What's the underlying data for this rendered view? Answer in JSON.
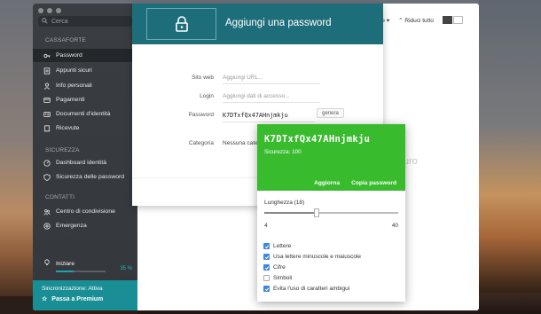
{
  "sidebar": {
    "search_placeholder": "Cerca",
    "section_vault": "CASSAFORTE",
    "vault_items": [
      {
        "label": "Password",
        "icon": "key-icon"
      },
      {
        "label": "Appunti sicuri",
        "icon": "note-icon"
      },
      {
        "label": "Info personali",
        "icon": "person-icon"
      },
      {
        "label": "Pagamenti",
        "icon": "card-icon"
      },
      {
        "label": "Documenti d'identità",
        "icon": "id-card-icon"
      },
      {
        "label": "Ricevute",
        "icon": "receipt-icon"
      }
    ],
    "section_security": "SICUREZZA",
    "security_items": [
      {
        "label": "Dashboard identità",
        "icon": "dashboard-icon"
      },
      {
        "label": "Sicurezza delle password",
        "icon": "shield-icon"
      }
    ],
    "section_contacts": "CONTATTI",
    "contact_items": [
      {
        "label": "Centro di condivisione",
        "icon": "share-icon"
      },
      {
        "label": "Emergenza",
        "icon": "emergency-icon"
      }
    ],
    "progress": {
      "label": "Iniziare",
      "percent_text": "35 %",
      "value": 0.35
    },
    "sync": {
      "status": "Sincronizzazione: Attiva",
      "premium": "Passa a Premium"
    }
  },
  "toolbar": {
    "sort_label": "me",
    "collapse_label": "Riduci tutto"
  },
  "background_text": "uro",
  "dialog": {
    "title": "Aggiungi una password",
    "fields": {
      "website_label": "Sito web",
      "website_placeholder": "Aggiungi URL...",
      "login_label": "Login",
      "login_placeholder": "Aggiungi dati di accesso...",
      "password_label": "Password",
      "password_value": "K7DTxfQx47AHnjmkju",
      "generate_label": "genera",
      "category_label": "Categoria",
      "category_value": "Nessuna categ"
    }
  },
  "generator": {
    "password": "K7DTxfQx47AHnjmkju",
    "strength": "Sicurezza: 100",
    "refresh": "Aggiorna",
    "copy": "Copia password",
    "length_label": "Lunghezza (18)",
    "length_value": 18,
    "length_min": "4",
    "length_max": "40",
    "options": [
      {
        "label": "Lettere",
        "checked": true
      },
      {
        "label": "Usa lettere minuscole e maiuscole",
        "checked": true
      },
      {
        "label": "Cifre",
        "checked": true
      },
      {
        "label": "Simboli",
        "checked": false
      },
      {
        "label": "Evita l'uso di caratteri ambigui",
        "checked": true
      }
    ]
  },
  "colors": {
    "accent": "#1e6d7a",
    "generator_green": "#39bb2e",
    "checkbox_blue": "#3f86e0",
    "sync_teal": "#1a8e95"
  }
}
